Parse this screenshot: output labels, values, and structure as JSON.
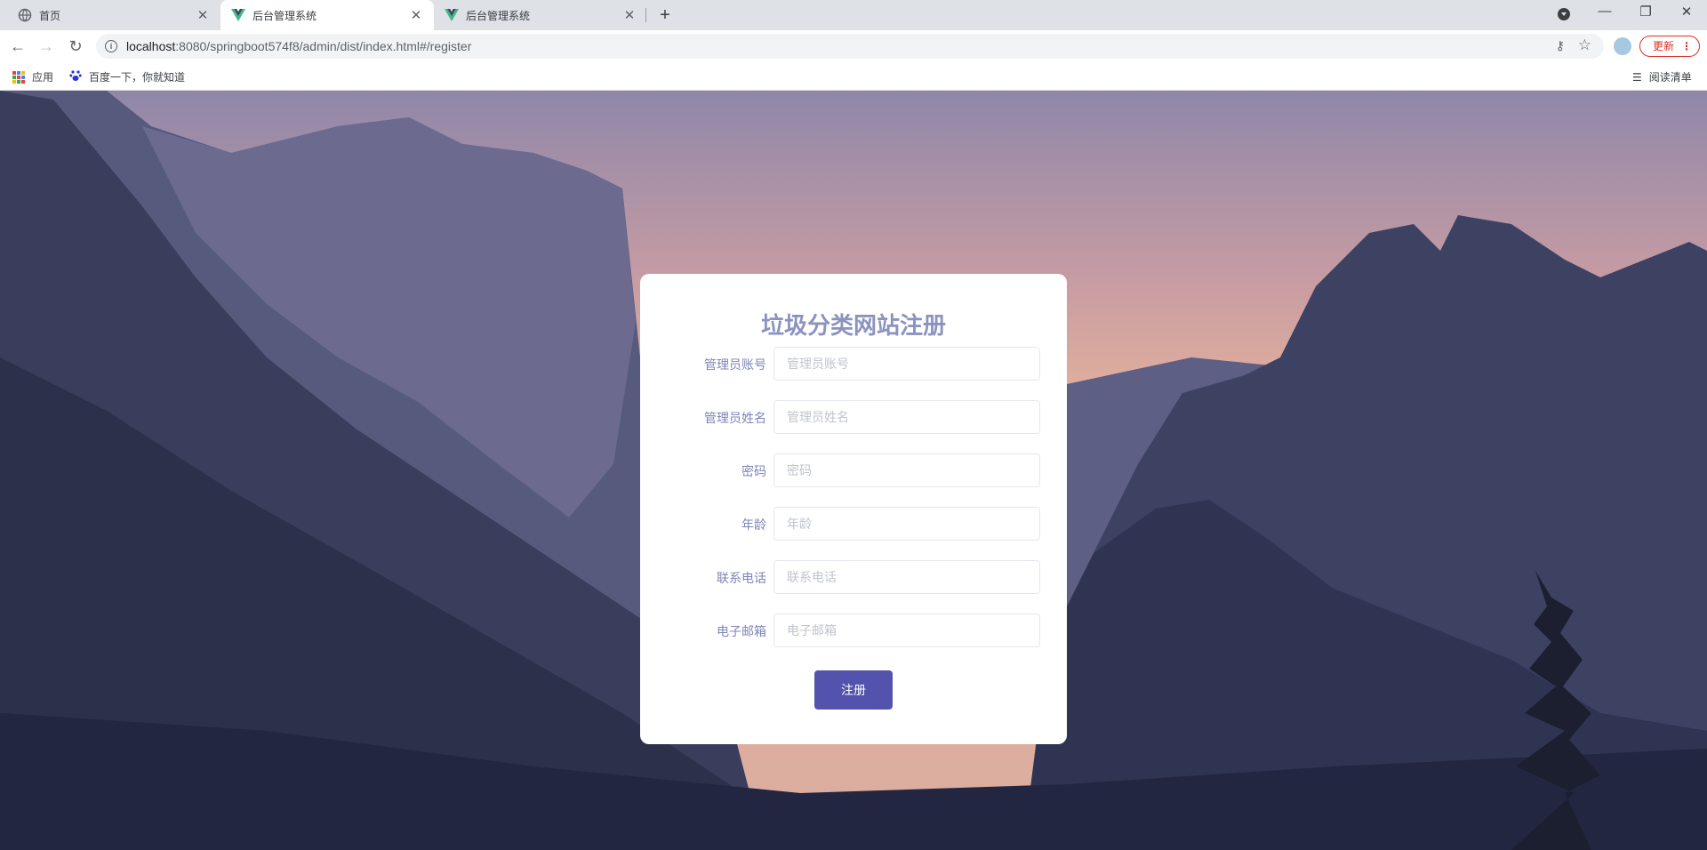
{
  "browser": {
    "tabs": [
      {
        "title": "首页",
        "active": false,
        "favicon": "globe-icon"
      },
      {
        "title": "后台管理系统",
        "active": true,
        "favicon": "vue-logo-icon"
      },
      {
        "title": "后台管理系统",
        "active": false,
        "favicon": "vue-logo-icon"
      }
    ],
    "address": {
      "host": "localhost",
      "rest": ":8080/springboot574f8/admin/dist/index.html#/register"
    },
    "update_label": "更新",
    "bookmarks": [
      {
        "label": "应用",
        "icon": "apps-grid-icon"
      },
      {
        "label": "百度一下，你就知道",
        "icon": "baidu-paw-icon"
      }
    ],
    "reading_list_label": "阅读清单"
  },
  "form": {
    "title": "垃圾分类网站注册",
    "fields": [
      {
        "label": "管理员账号",
        "placeholder": "管理员账号",
        "value": ""
      },
      {
        "label": "管理员姓名",
        "placeholder": "管理员姓名",
        "value": ""
      },
      {
        "label": "密码",
        "placeholder": "密码",
        "value": ""
      },
      {
        "label": "年龄",
        "placeholder": "年龄",
        "value": ""
      },
      {
        "label": "联系电话",
        "placeholder": "联系电话",
        "value": ""
      },
      {
        "label": "电子邮箱",
        "placeholder": "电子邮箱",
        "value": ""
      }
    ],
    "submit_label": "注册"
  },
  "colors": {
    "title": "#8b93c0",
    "label": "#7f84b8",
    "button": "#5352ac",
    "update_button": "#d93025"
  }
}
